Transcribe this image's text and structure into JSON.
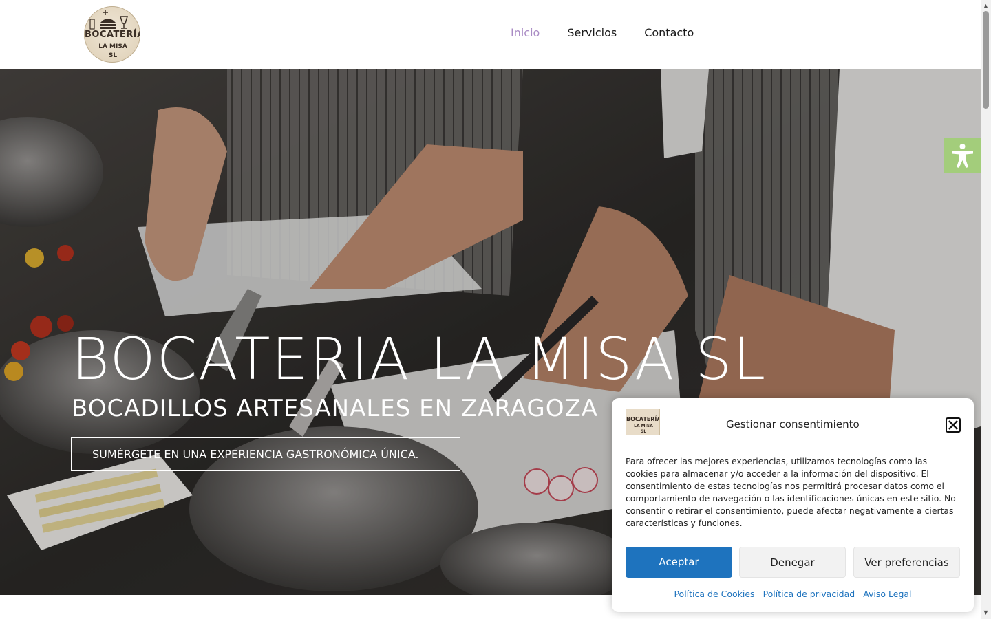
{
  "header": {
    "logo": {
      "line1": "BOCATERÍA",
      "line2": "LA MISA",
      "line3": "SL"
    },
    "nav": [
      {
        "label": "Inicio",
        "active": true
      },
      {
        "label": "Servicios",
        "active": false
      },
      {
        "label": "Contacto",
        "active": false
      }
    ]
  },
  "hero": {
    "title": "BOCATERIA LA MISA SL",
    "subtitle": "BOCADILLOS ARTESANALES EN ZARAGOZA",
    "tagline": "SUMÉRGETE EN UNA EXPERIENCIA GASTRONÓMICA ÚNICA."
  },
  "accessibility": {
    "icon": "accessibility-icon",
    "color": "#a3cd7b"
  },
  "cookie": {
    "title": "Gestionar consentimiento",
    "text": "Para ofrecer las mejores experiencias, utilizamos tecnologías como las cookies para almacenar y/o acceder a la información del dispositivo. El consentimiento de estas tecnologías nos permitirá procesar datos como el comportamiento de navegación o las identificaciones únicas en este sitio. No consentir o retirar el consentimiento, puede afectar negativamente a ciertas características y funciones.",
    "buttons": {
      "accept": "Aceptar",
      "deny": "Denegar",
      "preferences": "Ver preferencias"
    },
    "links": [
      "Política de Cookies",
      "Política de privacidad",
      "Aviso Legal"
    ],
    "accent_color": "#1e73be"
  },
  "colors": {
    "nav_active": "#a98bc4",
    "text": "#1a1a1a"
  }
}
